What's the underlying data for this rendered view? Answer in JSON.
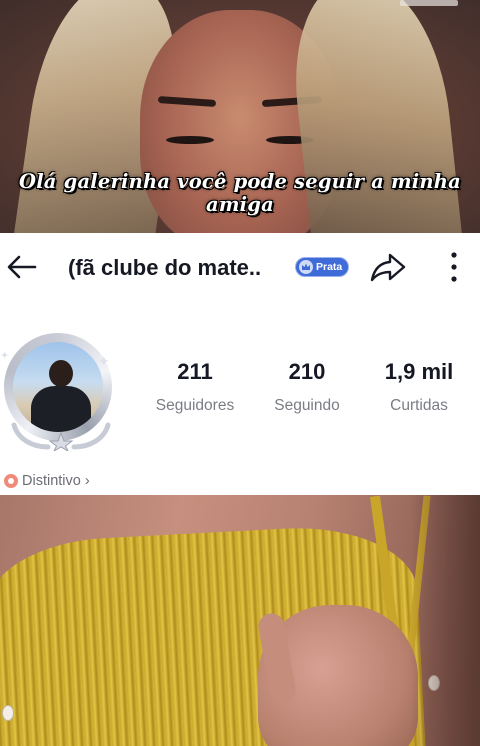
{
  "top_video": {
    "caption": "Olá galerinha você pode seguir a minha amiga"
  },
  "profile_header": {
    "back_icon": "arrow-left-icon",
    "title": "(fã  clube do mate..",
    "badge_label": "Prata",
    "badge_icon": "crown-icon",
    "share_icon": "share-arrow-icon",
    "more_icon": "more-vertical-icon"
  },
  "stats": [
    {
      "value": "211",
      "label": "Seguidores"
    },
    {
      "value": "210",
      "label": "Seguindo"
    },
    {
      "value": "1,9 mil",
      "label": "Curtidas"
    }
  ],
  "distintivo": {
    "label": "Distintivo",
    "chevron": "›"
  },
  "colors": {
    "text_primary": "#161823",
    "text_secondary": "#7b7d85",
    "badge_blue": "#3f6bd8",
    "distintivo_icon": "#f08a7a"
  }
}
